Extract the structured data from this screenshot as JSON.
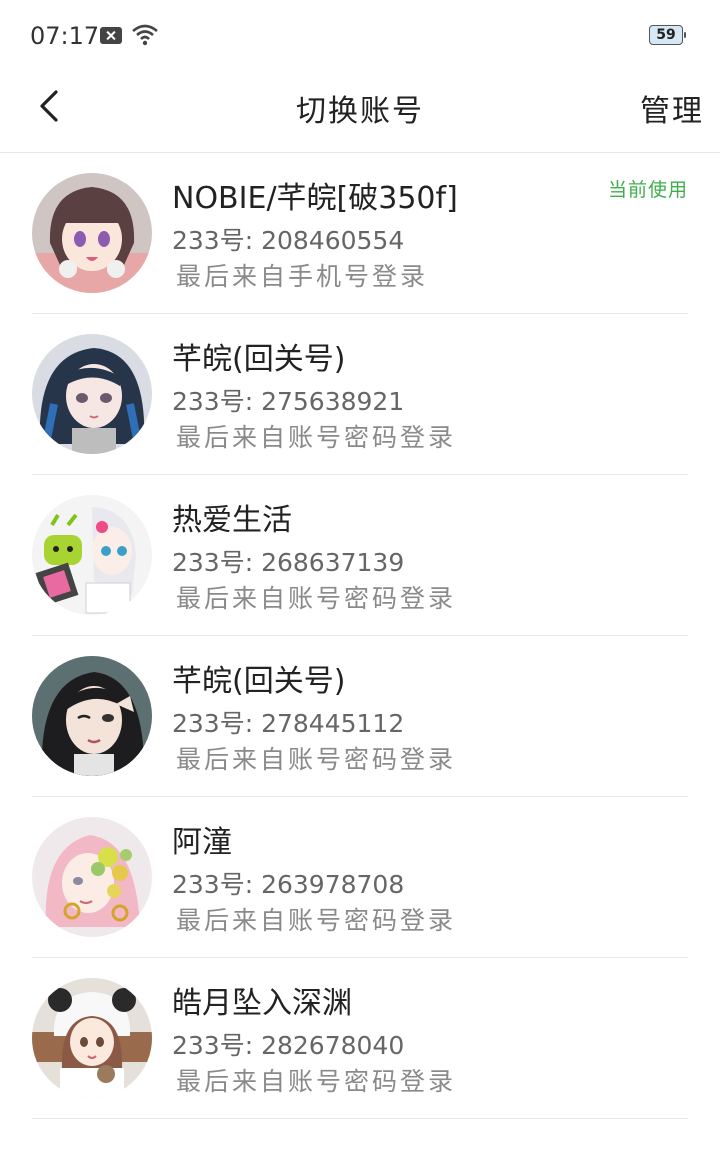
{
  "status_bar": {
    "time": "07:17",
    "battery": "59"
  },
  "nav": {
    "title": "切换账号",
    "manage_label": "管理"
  },
  "accounts": [
    {
      "name": "NOBIE/芊皖[破350f]",
      "uid": "233号: 208460554",
      "login": "最后来自手机号登录",
      "current": "当前使用"
    },
    {
      "name": "芊皖(回关号)",
      "uid": "233号: 275638921",
      "login": "最后来自账号密码登录"
    },
    {
      "name": "热爱生活",
      "uid": "233号: 268637139",
      "login": "最后来自账号密码登录"
    },
    {
      "name": "芊皖(回关号)",
      "uid": "233号: 278445112",
      "login": "最后来自账号密码登录"
    },
    {
      "name": "阿潼",
      "uid": "233号: 263978708",
      "login": "最后来自账号密码登录"
    },
    {
      "name": "皓月坠入深渊",
      "uid": "233号: 282678040",
      "login": "最后来自账号密码登录"
    }
  ]
}
